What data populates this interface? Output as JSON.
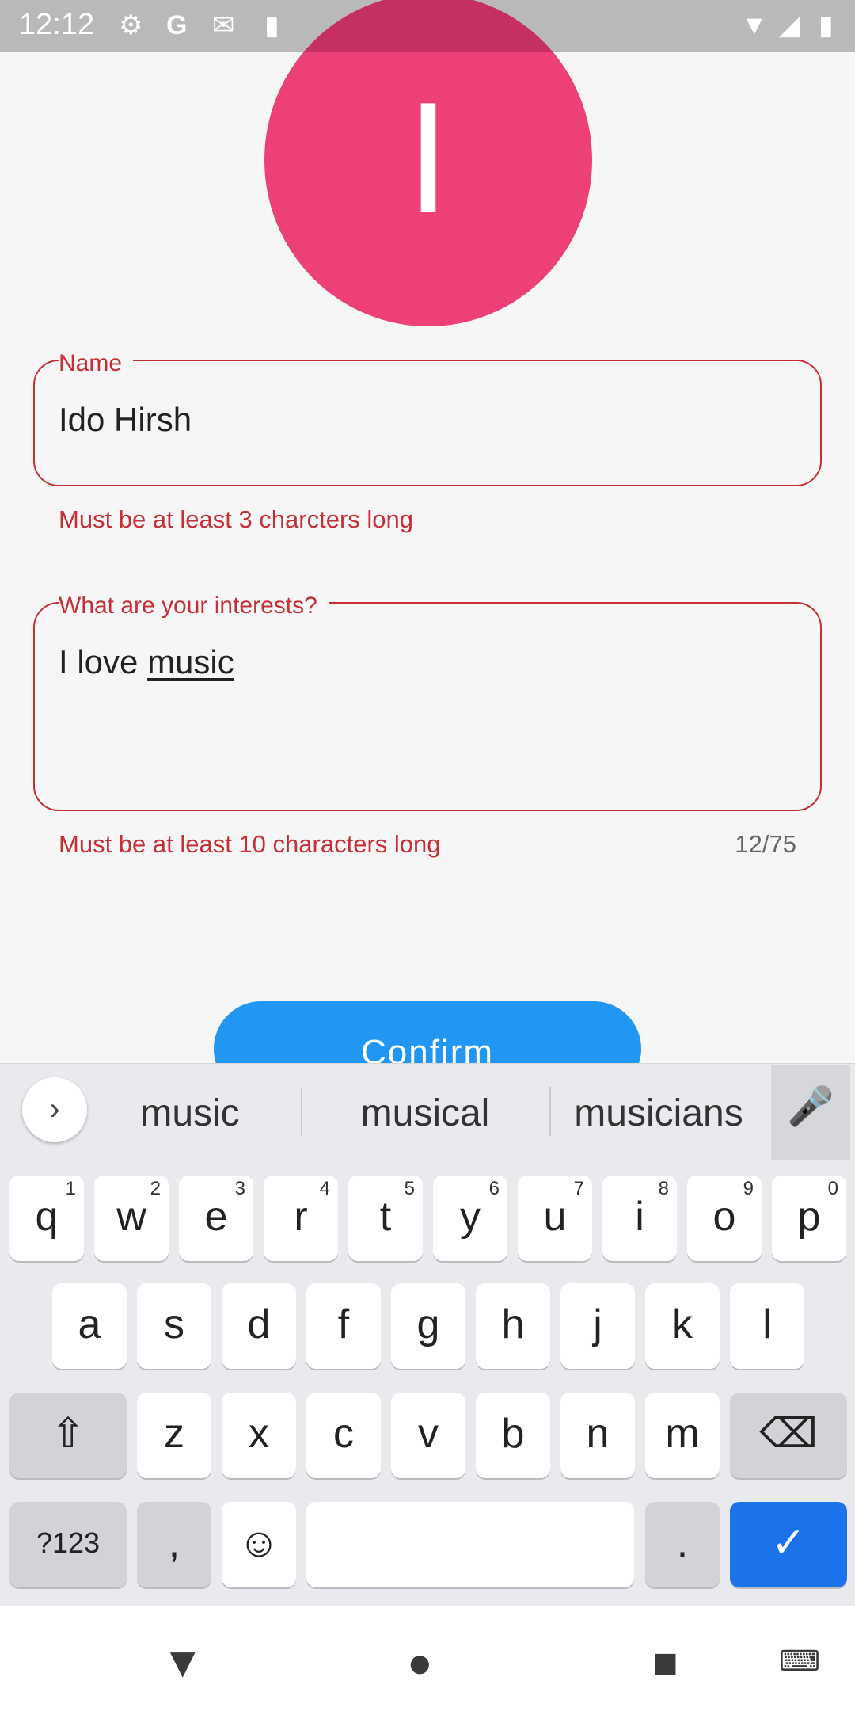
{
  "status_bar": {
    "time": "12:12",
    "icons": [
      "gear-icon",
      "google-g-icon",
      "mail-icon",
      "sd-card-icon",
      "wifi-icon",
      "signal-icon",
      "battery-icon"
    ]
  },
  "avatar": {
    "letter": "I",
    "color": "#ed4077"
  },
  "name_field": {
    "label": "Name",
    "value": "Ido Hirsh",
    "error": "Must be at least 3 charcters long"
  },
  "interests_field": {
    "label": "What are your interests?",
    "value_prefix": "I love ",
    "value_underlined": "music",
    "error": "Must be at least 10 characters long",
    "counter": "12/75"
  },
  "confirm_button": {
    "label": "Confirm",
    "color": "#2196f3"
  },
  "keyboard": {
    "suggestions": [
      "music",
      "musical",
      "musicians"
    ],
    "row1": [
      {
        "k": "q",
        "h": "1"
      },
      {
        "k": "w",
        "h": "2"
      },
      {
        "k": "e",
        "h": "3"
      },
      {
        "k": "r",
        "h": "4"
      },
      {
        "k": "t",
        "h": "5"
      },
      {
        "k": "y",
        "h": "6"
      },
      {
        "k": "u",
        "h": "7"
      },
      {
        "k": "i",
        "h": "8"
      },
      {
        "k": "o",
        "h": "9"
      },
      {
        "k": "p",
        "h": "0"
      }
    ],
    "row2": [
      "a",
      "s",
      "d",
      "f",
      "g",
      "h",
      "j",
      "k",
      "l"
    ],
    "row3": [
      "z",
      "x",
      "c",
      "v",
      "b",
      "n",
      "m"
    ],
    "symbols_label": "?123",
    "comma": ",",
    "period": ".",
    "accent_color": "#1a73e8"
  },
  "colors": {
    "error": "#c62f36"
  }
}
